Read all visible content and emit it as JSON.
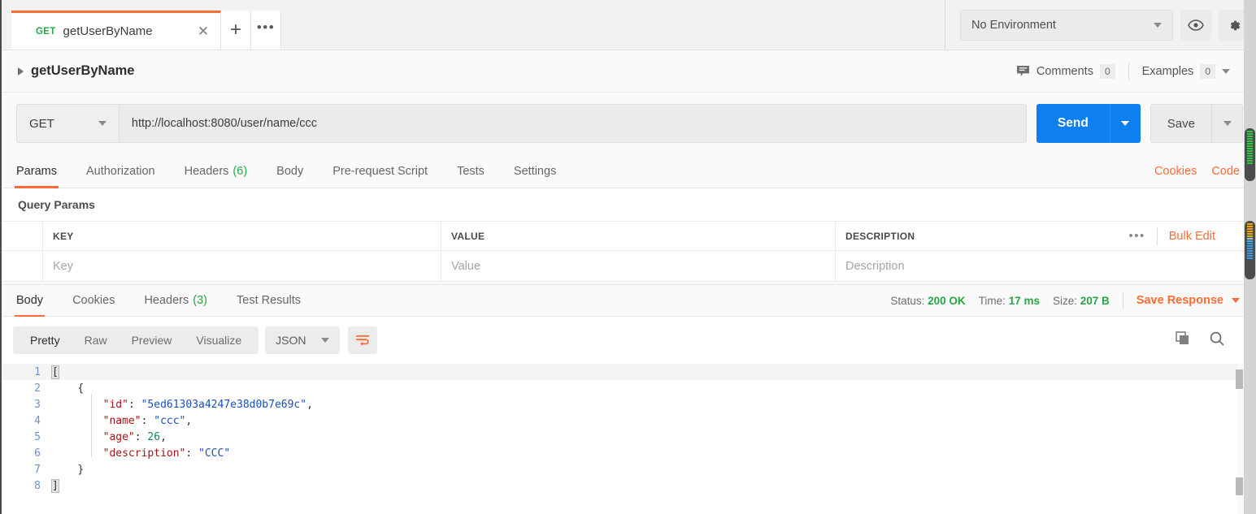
{
  "tabbar": {
    "request_tab": {
      "method": "GET",
      "name": "getUserByName",
      "close_icon": "close-icon"
    },
    "new_tab_label": "+",
    "more_label": "•••"
  },
  "environment": {
    "selected": "No Environment",
    "eye_icon": "eye-icon",
    "gear_icon": "gear-icon"
  },
  "breadcrumb": {
    "title": "getUserByName",
    "comments_label": "Comments",
    "comments_count": "0",
    "examples_label": "Examples",
    "examples_count": "0"
  },
  "url_bar": {
    "method": "GET",
    "url": "http://localhost:8080/user/name/ccc",
    "send_label": "Send",
    "save_label": "Save"
  },
  "request_tabs": {
    "items": [
      {
        "label": "Params",
        "count": "",
        "active": true
      },
      {
        "label": "Authorization",
        "count": "",
        "active": false
      },
      {
        "label": "Headers",
        "count": "(6)",
        "active": false
      },
      {
        "label": "Body",
        "count": "",
        "active": false
      },
      {
        "label": "Pre-request Script",
        "count": "",
        "active": false
      },
      {
        "label": "Tests",
        "count": "",
        "active": false
      },
      {
        "label": "Settings",
        "count": "",
        "active": false
      }
    ],
    "cookies_label": "Cookies",
    "code_label": "Code"
  },
  "params": {
    "section_label": "Query Params",
    "headers": {
      "key": "KEY",
      "value": "VALUE",
      "description": "DESCRIPTION"
    },
    "placeholders": {
      "key": "Key",
      "value": "Value",
      "description": "Description"
    },
    "bulk_edit_label": "Bulk Edit",
    "more_label": "•••"
  },
  "response_tabs": {
    "items": [
      {
        "label": "Body",
        "count": "",
        "active": true
      },
      {
        "label": "Cookies",
        "count": "",
        "active": false
      },
      {
        "label": "Headers",
        "count": "(3)",
        "active": false
      },
      {
        "label": "Test Results",
        "count": "",
        "active": false
      }
    ],
    "status_key": "Status:",
    "status_value": "200 OK",
    "time_key": "Time:",
    "time_value": "17 ms",
    "size_key": "Size:",
    "size_value": "207 B",
    "save_response_label": "Save Response"
  },
  "body_toolbar": {
    "views": [
      {
        "label": "Pretty",
        "active": true
      },
      {
        "label": "Raw",
        "active": false
      },
      {
        "label": "Preview",
        "active": false
      },
      {
        "label": "Visualize",
        "active": false
      }
    ],
    "format": "JSON",
    "wrap_icon": "word-wrap-icon",
    "copy_icon": "copy-icon",
    "search_icon": "search-icon"
  },
  "response_body": {
    "language": "json",
    "lines": [
      {
        "n": "1",
        "text": "["
      },
      {
        "n": "2",
        "text": "    {"
      },
      {
        "n": "3",
        "text": "        \"id\": \"5ed61303a4247e38d0b7e69c\","
      },
      {
        "n": "4",
        "text": "        \"name\": \"ccc\","
      },
      {
        "n": "5",
        "text": "        \"age\": 26,"
      },
      {
        "n": "6",
        "text": "        \"description\": \"CCC\""
      },
      {
        "n": "7",
        "text": "    }"
      },
      {
        "n": "8",
        "text": "]"
      }
    ],
    "parsed": [
      {
        "id": "5ed61303a4247e38d0b7e69c",
        "name": "ccc",
        "age": 26,
        "description": "CCC"
      }
    ]
  },
  "colors": {
    "accent": "#ff6c37",
    "send_blue": "#0d7ff1",
    "success_green": "#27a745",
    "json_string": "#1a4fbd",
    "json_key": "#a31515",
    "json_number": "#098658"
  }
}
